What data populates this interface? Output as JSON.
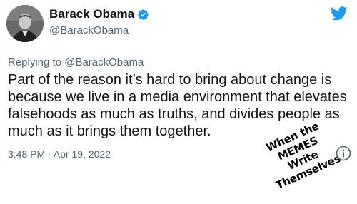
{
  "tweet": {
    "author": {
      "display_name": "Barack Obama",
      "handle": "@BarackObama",
      "verified": true,
      "avatar_icon": "avatar-photo"
    },
    "reply_prefix": "Replying to ",
    "reply_to": "@BarackObama",
    "text": "Part of the reason it’s hard to bring about change is because we live in a media environment that elevates falsehoods as much as truths, and divides people as much as it brings them together.",
    "timestamp": "3:48 PM · Apr 19, 2022",
    "brand_icon": "twitter-bird-icon",
    "info_icon": "info-icon"
  },
  "watermark": {
    "line1": "When the MEMES",
    "line2": "Write Themselves"
  },
  "colors": {
    "accent": "#1d9bf0",
    "text": "#0f1419",
    "secondary": "#536471"
  }
}
